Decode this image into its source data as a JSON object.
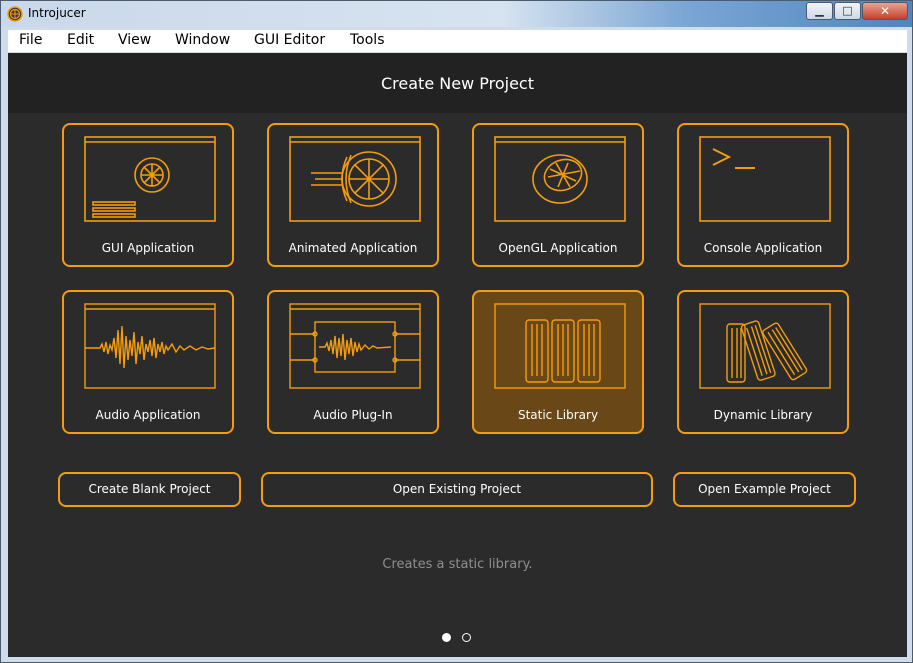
{
  "window": {
    "title": "Introjucer",
    "controls": {
      "minimize": "▁",
      "maximize": "□",
      "close": "✕"
    }
  },
  "menu": [
    "File",
    "Edit",
    "View",
    "Window",
    "GUI Editor",
    "Tools"
  ],
  "header": {
    "title": "Create New Project"
  },
  "templates": [
    {
      "label": "GUI Application",
      "icon": "gui-application-icon",
      "selected": false
    },
    {
      "label": "Animated Application",
      "icon": "animated-application-icon",
      "selected": false
    },
    {
      "label": "OpenGL Application",
      "icon": "opengl-application-icon",
      "selected": false
    },
    {
      "label": "Console Application",
      "icon": "console-application-icon",
      "selected": false
    },
    {
      "label": "Audio Application",
      "icon": "audio-application-icon",
      "selected": false
    },
    {
      "label": "Audio Plug-In",
      "icon": "audio-plugin-icon",
      "selected": false
    },
    {
      "label": "Static Library",
      "icon": "static-library-icon",
      "selected": true
    },
    {
      "label": "Dynamic Library",
      "icon": "dynamic-library-icon",
      "selected": false
    }
  ],
  "actions": {
    "blank": "Create Blank Project",
    "open_existing": "Open Existing Project",
    "open_example": "Open Example Project"
  },
  "description": "Creates a static library.",
  "pagination": {
    "current": 1,
    "total": 2
  },
  "colors": {
    "accent": "#f39c12",
    "background": "#2b2b2b",
    "header": "#222222",
    "selected_tile": "#6a4716"
  }
}
